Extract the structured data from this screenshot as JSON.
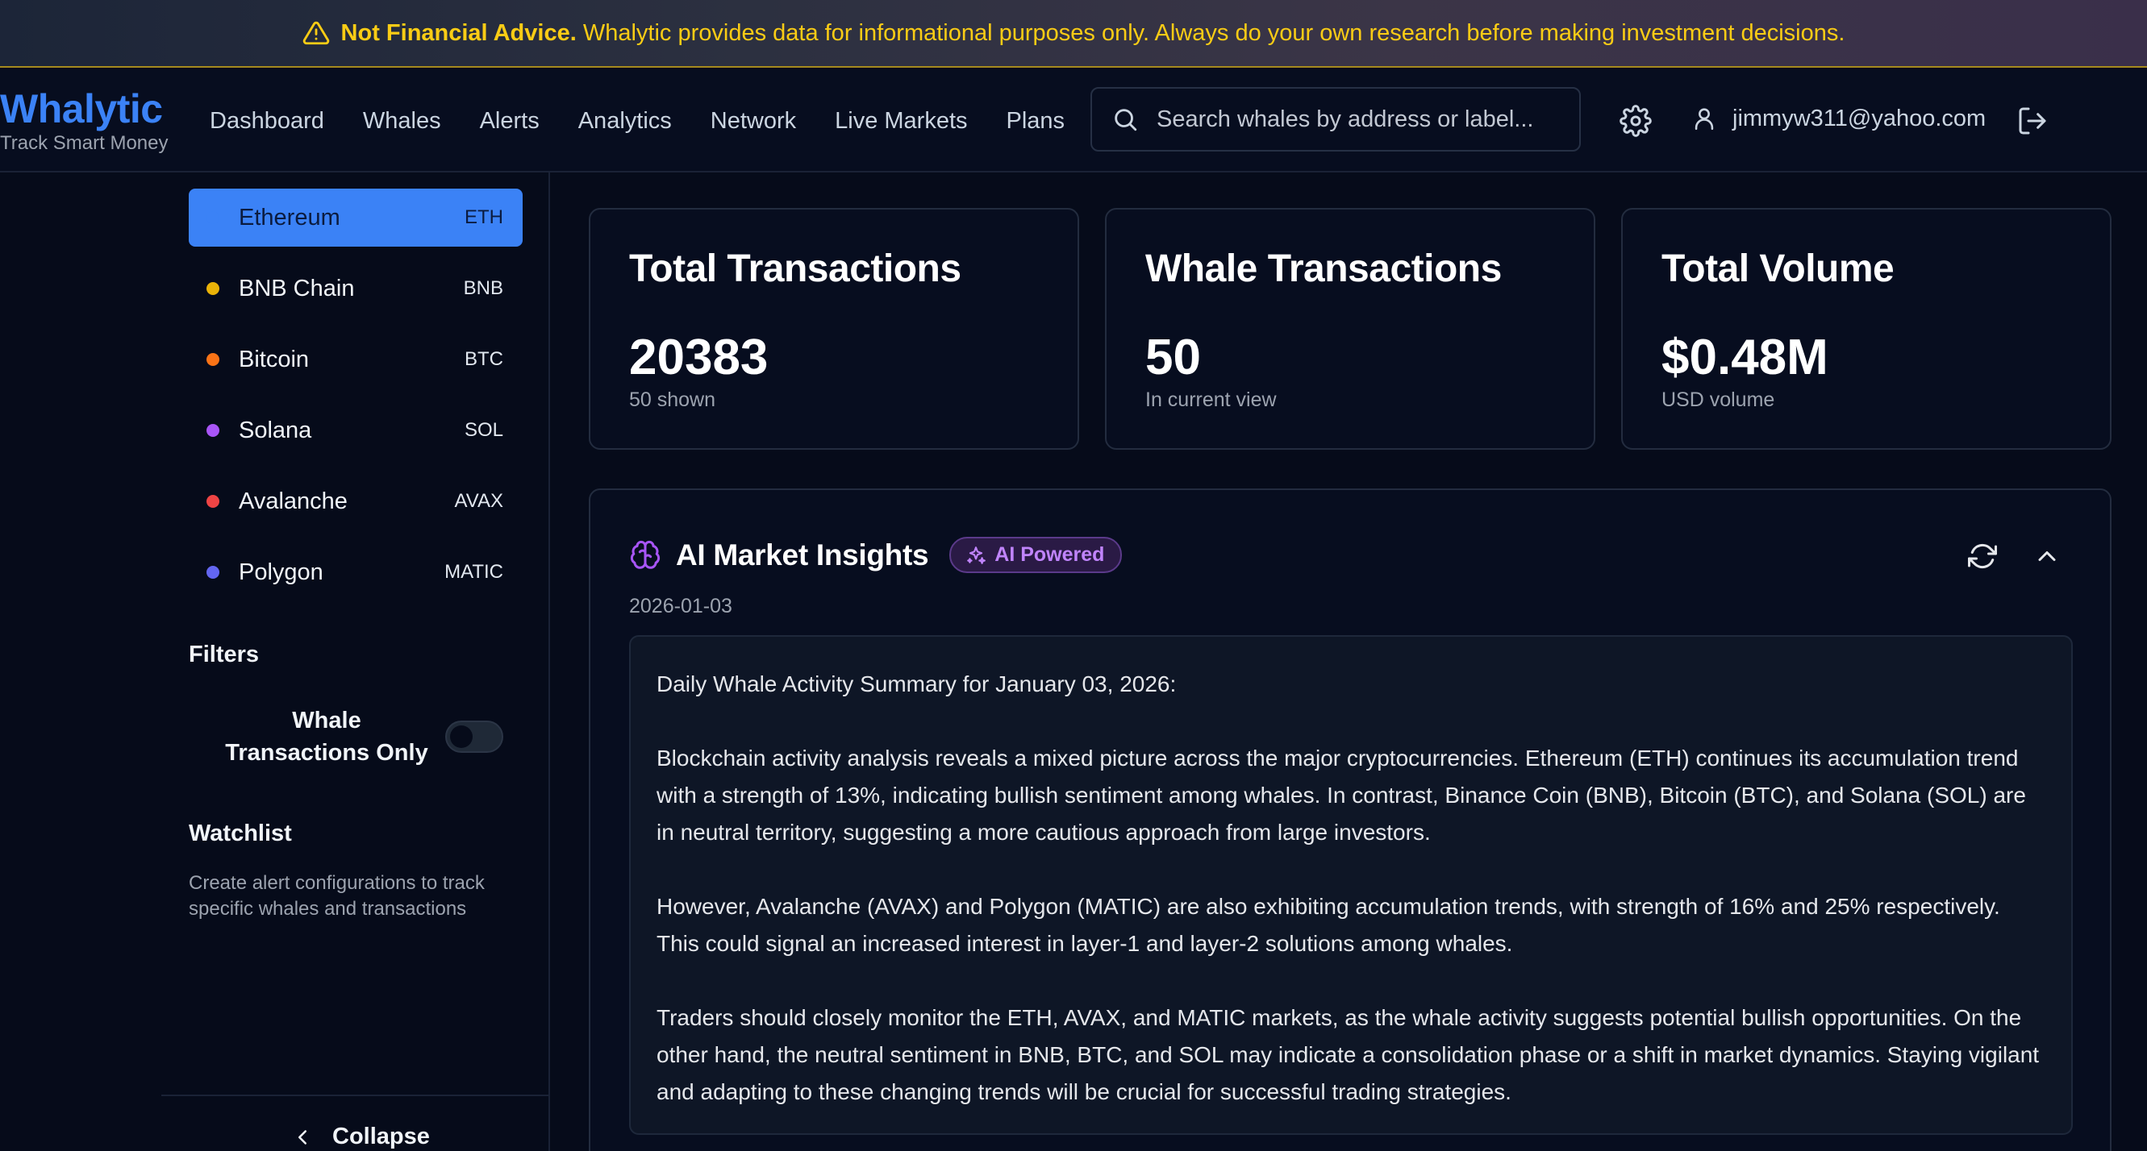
{
  "banner": {
    "bold": "Not Financial Advice.",
    "text": "Whalytic provides data for informational purposes only. Always do your own research before making investment decisions."
  },
  "header": {
    "brand": "Whalytic",
    "tagline": "Track Smart Money",
    "nav": [
      "Dashboard",
      "Whales",
      "Alerts",
      "Analytics",
      "Network",
      "Live Markets",
      "Plans"
    ],
    "search_placeholder": "Search whales by address or label...",
    "user_email": "jimmyw311@yahoo.com"
  },
  "sidebar": {
    "chains": [
      {
        "name": "Ethereum",
        "symbol": "ETH",
        "color": "#3b82f6",
        "active": true
      },
      {
        "name": "BNB Chain",
        "symbol": "BNB",
        "color": "#eab308",
        "active": false
      },
      {
        "name": "Bitcoin",
        "symbol": "BTC",
        "color": "#f97316",
        "active": false
      },
      {
        "name": "Solana",
        "symbol": "SOL",
        "color": "#a855f7",
        "active": false
      },
      {
        "name": "Avalanche",
        "symbol": "AVAX",
        "color": "#ef4444",
        "active": false
      },
      {
        "name": "Polygon",
        "symbol": "MATIC",
        "color": "#6366f1",
        "active": false
      }
    ],
    "filters_title": "Filters",
    "whale_only_label": "Whale Transactions Only",
    "whale_only_enabled": false,
    "watchlist_title": "Watchlist",
    "watchlist_desc": "Create alert configurations to track specific whales and transactions",
    "collapse_label": "Collapse"
  },
  "stats": [
    {
      "title": "Total Transactions",
      "value": "20383",
      "sub": "50 shown"
    },
    {
      "title": "Whale Transactions",
      "value": "50",
      "sub": "In current view"
    },
    {
      "title": "Total Volume",
      "value": "$0.48M",
      "sub": "USD volume"
    }
  ],
  "insights": {
    "title": "AI Market Insights",
    "badge": "AI Powered",
    "date": "2026-01-03",
    "paragraphs": [
      "Daily Whale Activity Summary for January 03, 2026:",
      "Blockchain activity analysis reveals a mixed picture across the major cryptocurrencies. Ethereum (ETH) continues its accumulation trend with a strength of 13%, indicating bullish sentiment among whales. In contrast, Binance Coin (BNB), Bitcoin (BTC), and Solana (SOL) are in neutral territory, suggesting a more cautious approach from large investors.",
      "However, Avalanche (AVAX) and Polygon (MATIC) are also exhibiting accumulation trends, with strength of 16% and 25% respectively. This could signal an increased interest in layer-1 and layer-2 solutions among whales.",
      "Traders should closely monitor the ETH, AVAX, and MATIC markets, as the whale activity suggests potential bullish opportunities. On the other hand, the neutral sentiment in BNB, BTC, and SOL may indicate a consolidation phase or a shift in market dynamics. Staying vigilant and adapting to these changing trends will be crucial for successful trading strategies."
    ]
  },
  "colors": {
    "accent": "#3b82f6",
    "warning": "#facc15",
    "ai_badge": "#c084fc"
  }
}
